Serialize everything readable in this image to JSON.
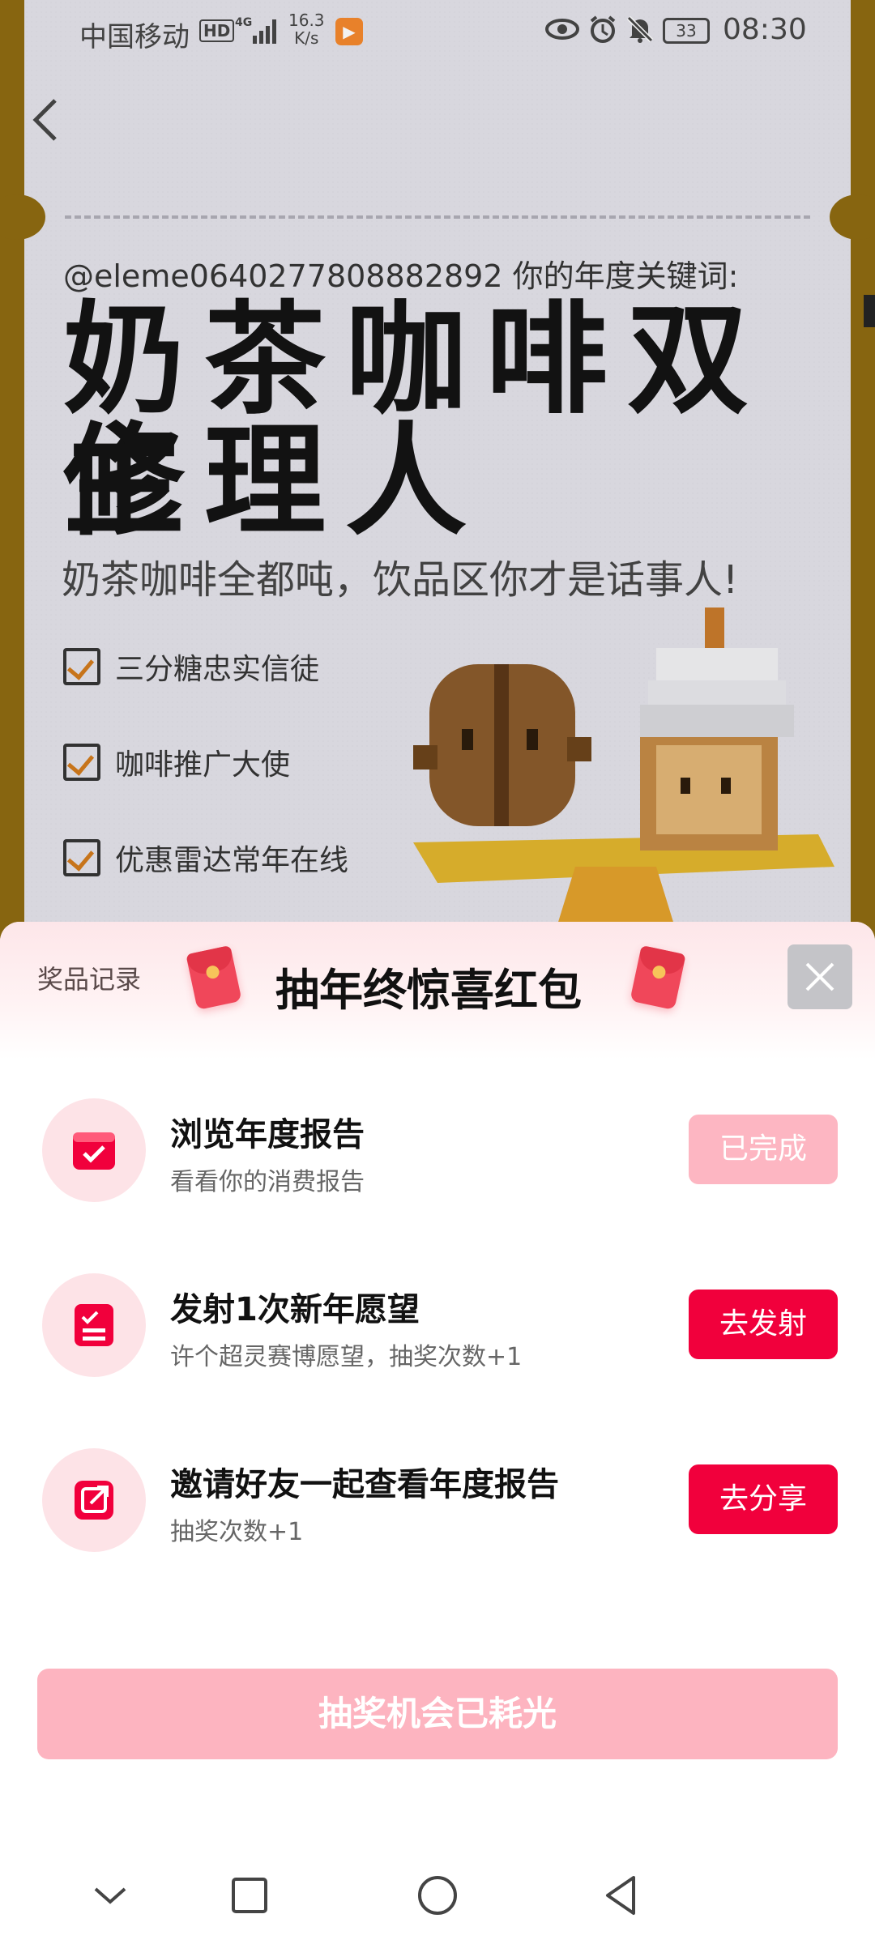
{
  "status_bar": {
    "carrier": "中国移动",
    "hd": "HD",
    "network": "4G",
    "speed_value": "16.3",
    "speed_unit": "K/s",
    "battery": "33",
    "time": "08:30"
  },
  "report": {
    "user_line": "@eleme0640277808882892 你的年度关键词:",
    "keyword_line1": "奶茶咖啡双修",
    "keyword_line2": "主理人",
    "subtitle": "奶茶咖啡全都吨，饮品区你才是话事人!",
    "checks": [
      {
        "label": "三分糖忠实信徒"
      },
      {
        "label": "咖啡推广大使"
      },
      {
        "label": "优惠雷达常年在线"
      }
    ]
  },
  "sheet": {
    "prize_record": "奖品记录",
    "title": "抽年终惊喜红包",
    "tasks": [
      {
        "title": "浏览年度报告",
        "desc": "看看你的消费报告",
        "button": "已完成",
        "icon": "calendar-check-icon"
      },
      {
        "title": "发射1次新年愿望",
        "desc": "许个超灵赛博愿望，抽奖次数+1",
        "button": "去发射",
        "icon": "list-check-icon"
      },
      {
        "title": "邀请好友一起查看年度报告",
        "desc": "抽奖次数+1",
        "button": "去分享",
        "icon": "share-edit-icon"
      }
    ],
    "draw_button": "抽奖机会已耗光"
  },
  "colors": {
    "accent": "#f1003c",
    "accent_light": "#fdb6c2",
    "icon_bg": "#fde3e7",
    "frame": "#8e6a0f"
  }
}
